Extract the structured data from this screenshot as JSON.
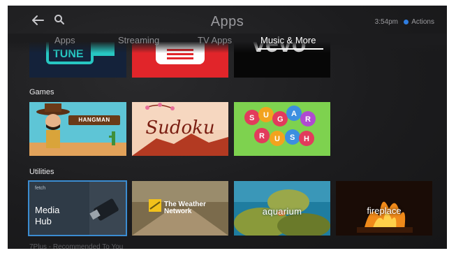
{
  "header": {
    "title": "Apps",
    "time": "3:54pm",
    "actions_label": "Actions"
  },
  "tabs": [
    {
      "label": "Apps",
      "active": false
    },
    {
      "label": "Streaming",
      "active": false
    },
    {
      "label": "TV Apps",
      "active": false
    },
    {
      "label": "Music & More",
      "active": true
    }
  ],
  "sections": {
    "games": "Games",
    "utilities": "Utilities",
    "next": "7Plus - Recommended To You"
  },
  "tiles": {
    "tunein": "TUNE",
    "vevo": "vevo",
    "hangman": "HANGMAN",
    "sudoku": "Sudoku",
    "sugar_rush": [
      "S",
      "U",
      "G",
      "A",
      "R",
      "R",
      "U",
      "S",
      "H"
    ],
    "fetch_brand": "fetch",
    "fetch_name": "Media Hub",
    "weather": "The Weather Network",
    "aquarium": "aquarium",
    "fireplace": "fireplace"
  },
  "colors": {
    "accent": "#2f7de1",
    "focus_border": "#3b8cd1"
  }
}
